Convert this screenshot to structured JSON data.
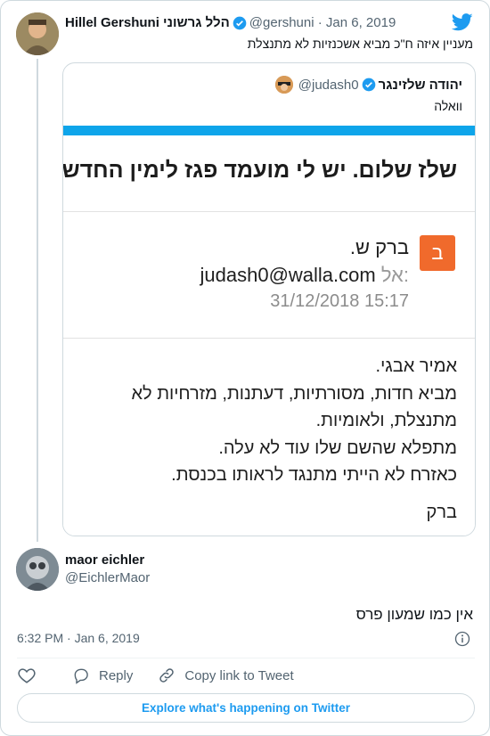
{
  "parent_tweet": {
    "display_name": "Hillel Gershuni הלל גרשוני",
    "handle": "@gershuni",
    "date": "Jan 6, 2019",
    "text": "מעניין איזה ח\"כ מביא אשכנזיות לא מתנצלת"
  },
  "quoted_tweet": {
    "display_name": "יהודה שלזינגר",
    "handle": "@judash0",
    "text": "וואלה",
    "email": {
      "subject": "שלז שלום. יש לי מועמד פגז לימין החדש",
      "badge_letter": "ב",
      "sender": "ברק ש.",
      "to_label": "אל:",
      "to_address": "judash0@walla.com",
      "datetime": "31/12/2018 15:17",
      "body": [
        "אמיר אבגי.",
        "מביא חדות, מסורתיות, דעתנות, מזרחיות לא",
        "מתנצלת, ולאומיות.",
        "מתפלא שהשם שלו עוד לא עלה.",
        "כאזרח לא הייתי מתנגד לראותו בכנסת."
      ],
      "signoff": "ברק"
    }
  },
  "reply_tweet": {
    "display_name": "maor eichler",
    "handle": "@EichlerMaor",
    "text": "אין כמו שמעון פרס",
    "time": "6:32 PM · Jan 6, 2019"
  },
  "actions": {
    "reply_label": "Reply",
    "copy_link_label": "Copy link to Tweet"
  },
  "explore_label": "Explore what's happening on Twitter",
  "colors": {
    "accent": "#1d9bf0",
    "email_bar": "#0ea5ea",
    "badge": "#f06a2c"
  }
}
